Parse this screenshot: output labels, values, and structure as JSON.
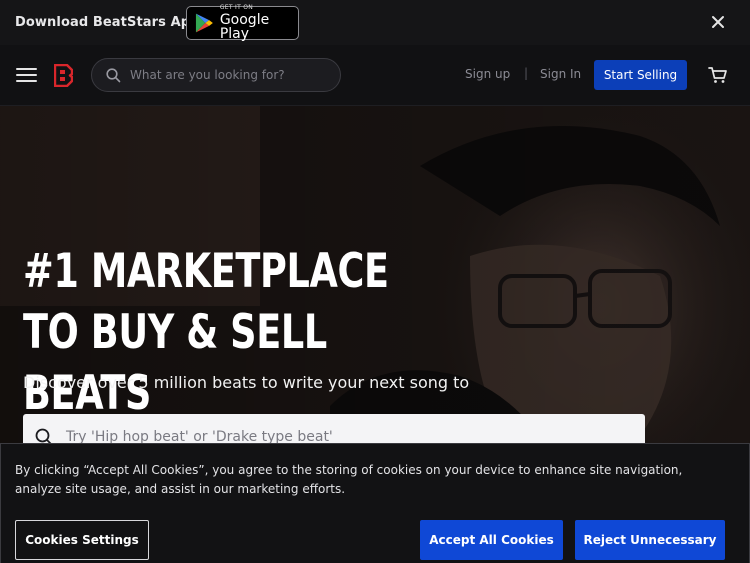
{
  "app_banner": {
    "title": "Download BeatStars App",
    "badge_small": "GET IT ON",
    "badge_big": "Google Play",
    "close_icon": "close-icon"
  },
  "nav": {
    "menu_icon": "hamburger-icon",
    "logo_icon": "beatstars-logo",
    "search_placeholder": "What are you looking for?",
    "signup": "Sign up",
    "separator": "|",
    "signin": "Sign In",
    "start_selling": "Start Selling",
    "cart_icon": "cart-icon",
    "accent": "#0c3fb8"
  },
  "hero": {
    "title": "#1 MARKETPLACE TO BUY & SELL BEATS",
    "subtitle": "Discover over 5 million beats to write your next song to",
    "search_placeholder": "Try 'Hip hop beat' or 'Drake type beat'"
  },
  "cookie": {
    "message": "By clicking “Accept All Cookies”, you agree to the storing of cookies on your device to enhance site navigation, analyze site usage, and assist in our marketing efforts.",
    "settings": "Cookies Settings",
    "accept": "Accept All Cookies",
    "reject": "Reject Unnecessary",
    "button_color": "#0f48d6"
  }
}
